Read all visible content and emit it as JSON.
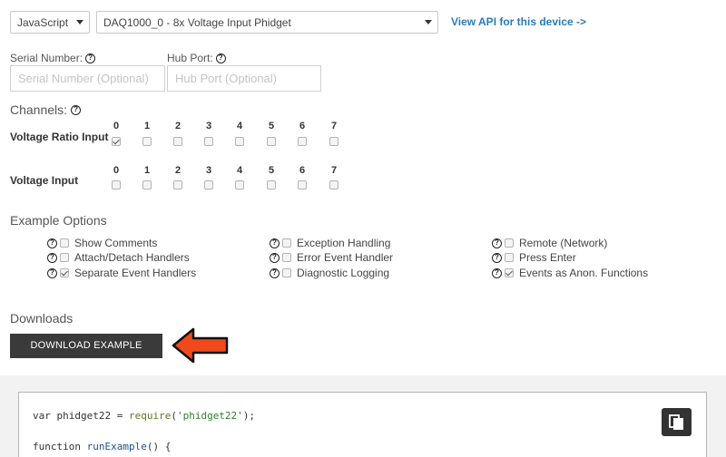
{
  "toolbar": {
    "language": "JavaScript",
    "device": "DAQ1000_0 - 8x Voltage Input Phidget",
    "api_link": "View API for this device ->"
  },
  "fields": {
    "serial_label": "Serial Number:",
    "serial_placeholder": "Serial Number (Optional)",
    "hub_label": "Hub Port:",
    "hub_placeholder": "Hub Port (Optional)"
  },
  "channels": {
    "title": "Channels:",
    "numbers": [
      "0",
      "1",
      "2",
      "3",
      "4",
      "5",
      "6",
      "7"
    ],
    "groups": [
      {
        "label": "Voltage Ratio Input",
        "checked": [
          true,
          false,
          false,
          false,
          false,
          false,
          false,
          false
        ]
      },
      {
        "label": "Voltage Input",
        "checked": [
          false,
          false,
          false,
          false,
          false,
          false,
          false,
          false
        ]
      }
    ]
  },
  "options": {
    "title": "Example Options",
    "items": [
      {
        "label": "Show Comments",
        "checked": false
      },
      {
        "label": "Attach/Detach Handlers",
        "checked": false
      },
      {
        "label": "Separate Event Handlers",
        "checked": true
      },
      {
        "label": "Exception Handling",
        "checked": false
      },
      {
        "label": "Error Event Handler",
        "checked": false
      },
      {
        "label": "Diagnostic Logging",
        "checked": false
      },
      {
        "label": "Remote (Network)",
        "checked": false
      },
      {
        "label": "Press Enter",
        "checked": false
      },
      {
        "label": "Events as Anon. Functions",
        "checked": true
      }
    ]
  },
  "downloads": {
    "title": "Downloads",
    "button": "DOWNLOAD EXAMPLE"
  },
  "code": {
    "line1_var": "var phidget22 = ",
    "line1_call": "require",
    "line1_open": "(",
    "line1_str": "'phidget22'",
    "line1_close": ");",
    "line2_kw": "function ",
    "line2_name": "runExample",
    "line2_rest": "() {"
  },
  "colors": {
    "link": "#2b7bb9",
    "button": "#3a3a3a",
    "arrow": "#f04a1c"
  },
  "icons": [
    "help-icon",
    "chevron-down-icon",
    "copy-icon",
    "arrow-left-icon"
  ]
}
